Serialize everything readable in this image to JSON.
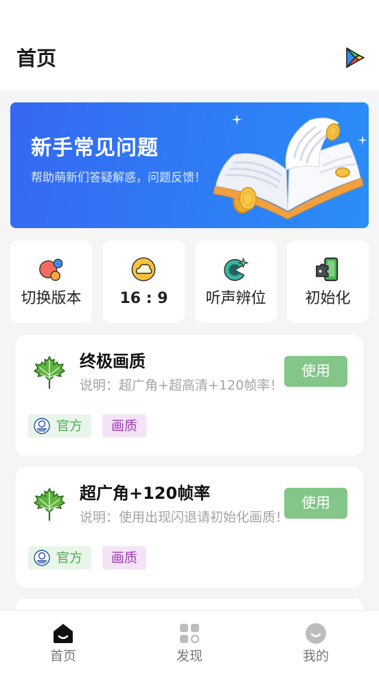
{
  "header": {
    "title": "首页",
    "store_icon": "play-store-icon"
  },
  "banner": {
    "title": "新手常见问题",
    "subtitle": "帮助萌新们答疑解惑，问题反馈！",
    "illustration_icon": "open-book-icon"
  },
  "quick_actions": [
    {
      "label": "切换版本",
      "icon": "bubbles-icon"
    },
    {
      "label": "16 : 9",
      "icon": "cloud-icon"
    },
    {
      "label": "听声辨位",
      "icon": "sound-locate-icon"
    },
    {
      "label": "初始化",
      "icon": "phone-puzzle-icon"
    }
  ],
  "presets": [
    {
      "title": "终极画质",
      "description": "说明：超广角+超高清+120帧率！",
      "button_label": "使用",
      "icon": "maple-leaf-icon",
      "tags": [
        {
          "label": "官方",
          "icon": "official-logo-icon"
        },
        {
          "label": "画质"
        }
      ]
    },
    {
      "title": "超广角+120帧率",
      "description": "说明：使用出现闪退请初始化画质！",
      "button_label": "使用",
      "icon": "maple-leaf-icon",
      "tags": [
        {
          "label": "官方",
          "icon": "official-logo-icon"
        },
        {
          "label": "画质"
        }
      ]
    }
  ],
  "bottom_nav": {
    "items": [
      {
        "label": "首页",
        "icon": "home-icon",
        "active": true
      },
      {
        "label": "发现",
        "icon": "discover-icon",
        "active": false
      },
      {
        "label": "我的",
        "icon": "profile-icon",
        "active": false
      }
    ]
  },
  "colors": {
    "page_bg": "#f5f5f5",
    "banner_start": "#3568f2",
    "banner_end": "#2a8ef8",
    "use_button": "#84c688",
    "tag_official_bg": "#e8f5e9",
    "tag_official_text": "#4caf50",
    "tag_quality_bg": "#f4e3f6",
    "tag_quality_text": "#9c3bb0"
  }
}
